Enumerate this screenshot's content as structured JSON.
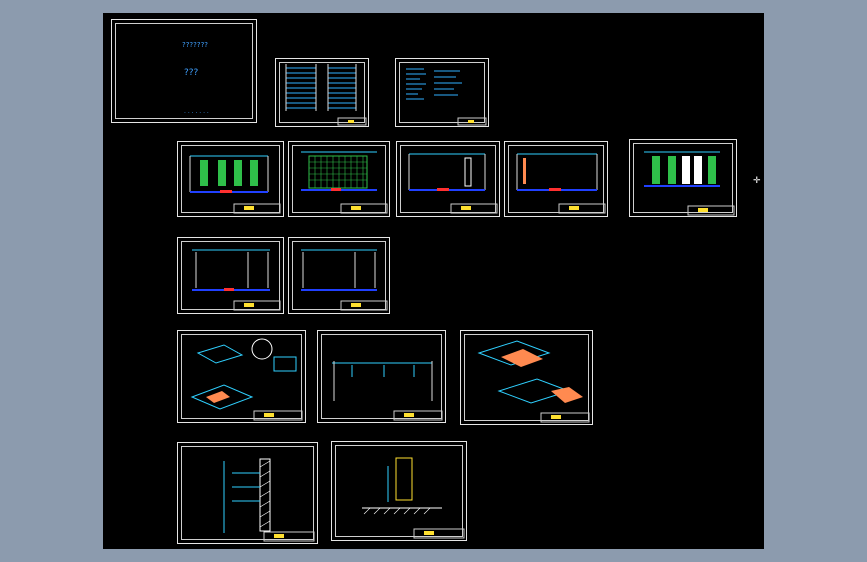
{
  "cover": {
    "title": "???????",
    "subtitle": "???",
    "footer": ". . . . . . ."
  },
  "colors": {
    "background": "#8c9bae",
    "canvas": "#000000",
    "frame": "#e6e6e6",
    "accent_blue": "#2040ff",
    "accent_cyan": "#2fd0ff",
    "accent_green": "#2fbf4a",
    "accent_orange": "#ff8a50",
    "accent_yellow": "#ffe030"
  },
  "cursor_icon": "crosshair-icon"
}
